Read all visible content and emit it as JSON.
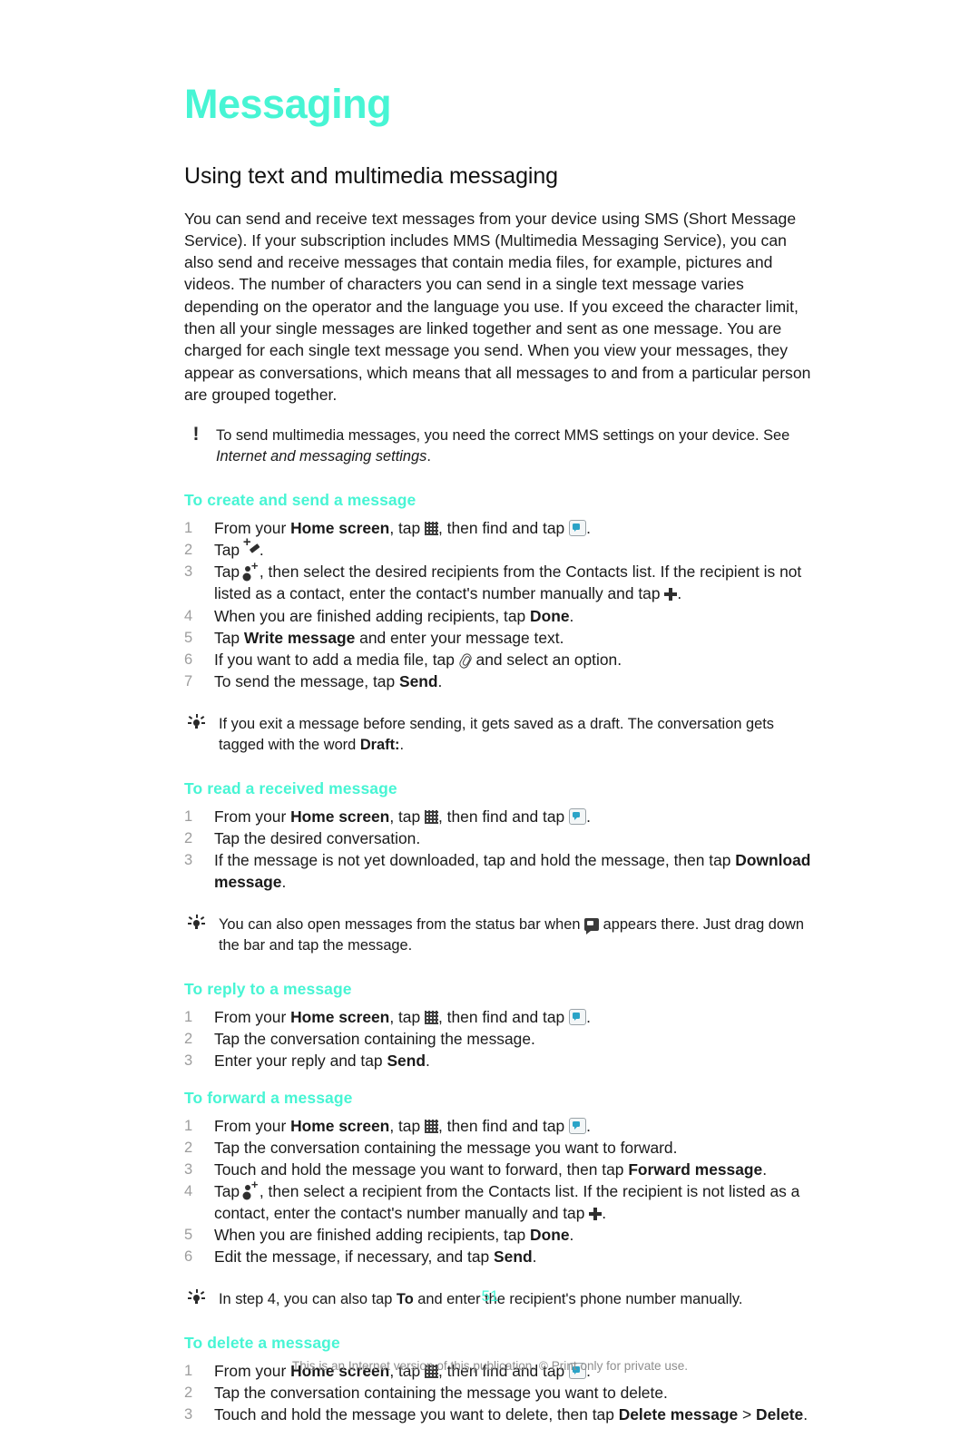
{
  "colors": {
    "accent": "#47f5d4",
    "body_text": "#1a1a1a",
    "step_number": "#9d9d9d",
    "footer_text": "#8e8e8e"
  },
  "chapter": {
    "title": "Messaging"
  },
  "section": {
    "title": "Using text and multimedia messaging",
    "intro": "You can send and receive text messages from your device using SMS (Short Message Service). If your subscription includes MMS (Multimedia Messaging Service), you can also send and receive messages that contain media files, for example, pictures and videos. The number of characters you can send in a single text message varies depending on the operator and the language you use. If you exceed the character limit, then all your single messages are linked together and sent as one message. You are charged for each single text message you send. When you view your messages, they appear as conversations, which means that all messages to and from a particular person are grouped together."
  },
  "note_mms": {
    "icon": "exclamation-icon",
    "text": "To send multimedia messages, you need the correct MMS settings on your device. See ",
    "italic_ref": "Internet and messaging settings",
    "tail": "."
  },
  "proc_create": {
    "title": "To create and send a message",
    "steps": [
      {
        "num": "1",
        "t1": "From your ",
        "b1": "Home screen",
        "t2": ", tap ",
        "icon1": "app-grid-icon",
        "t3": ", then find and tap ",
        "icon2": "messaging-app-icon",
        "t4": "."
      },
      {
        "num": "2",
        "t1": "Tap ",
        "icon1": "new-message-icon",
        "t2": "."
      },
      {
        "num": "3",
        "t1": "Tap ",
        "icon1": "add-contact-icon",
        "t2": ", then select the desired recipients from the Contacts list. If the recipient is not listed as a contact, enter the contact's number manually and tap ",
        "icon2": "plus-icon",
        "t3": "."
      },
      {
        "num": "4",
        "t1": "When you are finished adding recipients, tap ",
        "b1": "Done",
        "t2": "."
      },
      {
        "num": "5",
        "t1": "Tap ",
        "b1": "Write message",
        "t2": " and enter your message text."
      },
      {
        "num": "6",
        "t1": "If you want to add a media file, tap ",
        "icon1": "paperclip-icon",
        "t2": " and select an option."
      },
      {
        "num": "7",
        "t1": "To send the message, tap ",
        "b1": "Send",
        "t2": "."
      }
    ]
  },
  "tip_draft": {
    "icon": "lightbulb-icon",
    "t1": "If you exit a message before sending, it gets saved as a draft. The conversation gets tagged with the word ",
    "b1": "Draft:",
    "t2": "."
  },
  "proc_read": {
    "title": "To read a received message",
    "steps": [
      {
        "num": "1",
        "t1": "From your ",
        "b1": "Home screen",
        "t2": ", tap ",
        "icon1": "app-grid-icon",
        "t3": ", then find and tap ",
        "icon2": "messaging-app-icon",
        "t4": "."
      },
      {
        "num": "2",
        "t1": "Tap the desired conversation."
      },
      {
        "num": "3",
        "t1": "If the message is not yet downloaded, tap and hold the message, then tap ",
        "b1": "Download message",
        "t2": "."
      }
    ]
  },
  "tip_statusbar": {
    "icon": "lightbulb-icon",
    "t1": "You can also open messages from the status bar when ",
    "icon1": "status-bar-message-icon",
    "t2": " appears there. Just drag down the bar and tap the message."
  },
  "proc_reply": {
    "title": "To reply to a message",
    "steps": [
      {
        "num": "1",
        "t1": "From your ",
        "b1": "Home screen",
        "t2": ", tap ",
        "icon1": "app-grid-icon",
        "t3": ", then find and tap ",
        "icon2": "messaging-app-icon",
        "t4": "."
      },
      {
        "num": "2",
        "t1": "Tap the conversation containing the message."
      },
      {
        "num": "3",
        "t1": "Enter your reply and tap ",
        "b1": "Send",
        "t2": "."
      }
    ]
  },
  "proc_forward": {
    "title": "To forward a message",
    "steps": [
      {
        "num": "1",
        "t1": "From your ",
        "b1": "Home screen",
        "t2": ", tap ",
        "icon1": "app-grid-icon",
        "t3": ", then find and tap ",
        "icon2": "messaging-app-icon",
        "t4": "."
      },
      {
        "num": "2",
        "t1": "Tap the conversation containing the message you want to forward."
      },
      {
        "num": "3",
        "t1": "Touch and hold the message you want to forward, then tap ",
        "b1": "Forward message",
        "t2": "."
      },
      {
        "num": "4",
        "t1": "Tap ",
        "icon1": "add-contact-icon",
        "t2": ", then select a recipient from the Contacts list. If the recipient is not listed as a contact, enter the contact's number manually and tap ",
        "icon2": "plus-icon",
        "t3": "."
      },
      {
        "num": "5",
        "t1": "When you are finished adding recipients, tap ",
        "b1": "Done",
        "t2": "."
      },
      {
        "num": "6",
        "t1": "Edit the message, if necessary, and tap ",
        "b1": "Send",
        "t2": "."
      }
    ]
  },
  "tip_step4": {
    "icon": "lightbulb-icon",
    "t1": "In step 4, you can also tap ",
    "b1": "To",
    "t2": " and enter the recipient's phone number manually."
  },
  "proc_delete": {
    "title": "To delete a message",
    "steps": [
      {
        "num": "1",
        "t1": "From your ",
        "b1": "Home screen",
        "t2": ", tap ",
        "icon1": "app-grid-icon",
        "t3": ", then find and tap ",
        "icon2": "messaging-app-icon",
        "t4": "."
      },
      {
        "num": "2",
        "t1": "Tap the conversation containing the message you want to delete."
      },
      {
        "num": "3",
        "t1": "Touch and hold the message you want to delete, then tap ",
        "b1": "Delete message",
        "t2": " > ",
        "b2": "Delete",
        "t3": "."
      }
    ]
  },
  "footer": {
    "page_number": "51",
    "copyright": "This is an Internet version of this publication. © Print only for private use."
  }
}
